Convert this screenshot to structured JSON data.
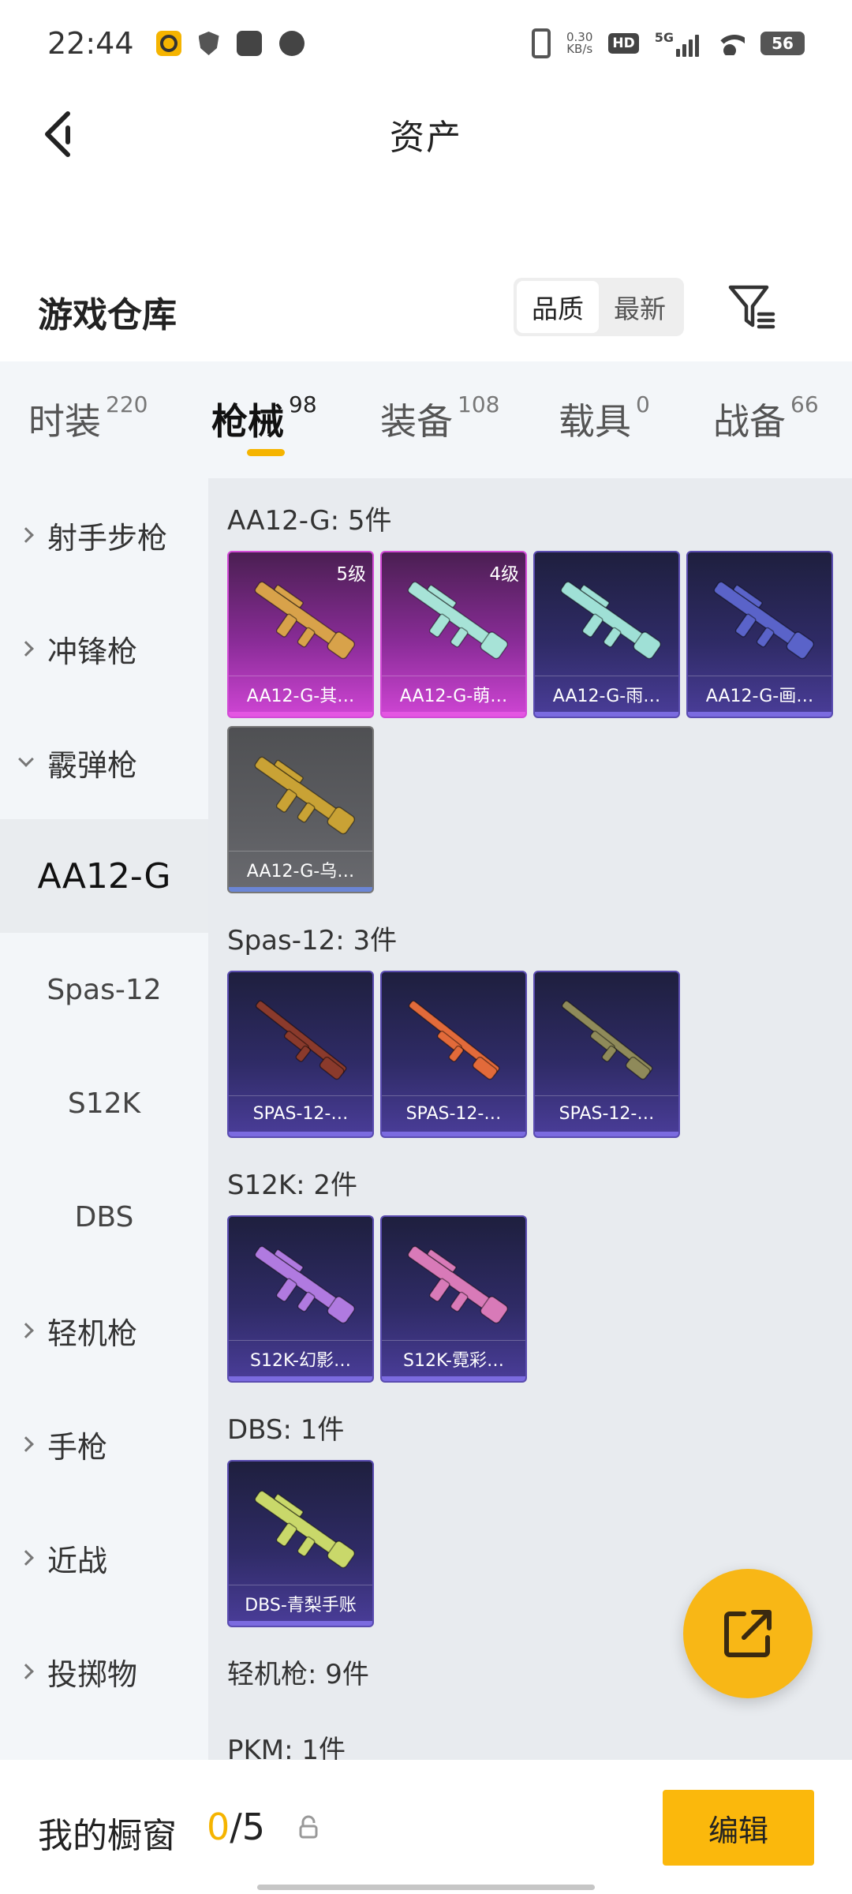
{
  "status_bar": {
    "time": "22:44",
    "net_speed_value": "0.30",
    "net_speed_unit": "KB/s",
    "hd": "HD",
    "network": "5G",
    "battery": "56"
  },
  "header": {
    "title": "资产"
  },
  "warehouse": {
    "title": "游戏仓库",
    "sort_options": [
      "品质",
      "最新"
    ],
    "active_sort": "品质"
  },
  "tabs": [
    {
      "label": "时装",
      "count": "220"
    },
    {
      "label": "枪械",
      "count": "98"
    },
    {
      "label": "装备",
      "count": "108"
    },
    {
      "label": "载具",
      "count": "0"
    },
    {
      "label": "战备",
      "count": "66"
    }
  ],
  "active_tab": "枪械",
  "sidenav": [
    {
      "label": "射手步枪"
    },
    {
      "label": "冲锋枪"
    },
    {
      "label": "霰弹枪"
    },
    {
      "label": "AA12-G"
    },
    {
      "label": "Spas-12"
    },
    {
      "label": "S12K"
    },
    {
      "label": "DBS"
    },
    {
      "label": "轻机枪"
    },
    {
      "label": "手枪"
    },
    {
      "label": "近战"
    },
    {
      "label": "投掷物"
    }
  ],
  "groups": [
    {
      "title": "AA12-G: 5件",
      "items": [
        {
          "name": "AA12-G-其…",
          "level": "5级",
          "rarity": "pink",
          "gun_color": "#d8a24a"
        },
        {
          "name": "AA12-G-萌…",
          "level": "4级",
          "rarity": "pink",
          "gun_color": "#a7e3d7"
        },
        {
          "name": "AA12-G-雨…",
          "level": "",
          "rarity": "purple",
          "gun_color": "#9fe0d6"
        },
        {
          "name": "AA12-G-画…",
          "level": "",
          "rarity": "purple",
          "gun_color": "#5a63c9"
        },
        {
          "name": "AA12-G-乌…",
          "level": "",
          "rarity": "gray",
          "gun_color": "#c9a235"
        }
      ]
    },
    {
      "title": "Spas-12: 3件",
      "items": [
        {
          "name": "SPAS-12-…",
          "level": "",
          "rarity": "purple",
          "gun_color": "#8a3a2c"
        },
        {
          "name": "SPAS-12-…",
          "level": "",
          "rarity": "purple",
          "gun_color": "#e26a3a"
        },
        {
          "name": "SPAS-12-…",
          "level": "",
          "rarity": "purple",
          "gun_color": "#8f8a5a"
        }
      ]
    },
    {
      "title": "S12K: 2件",
      "items": [
        {
          "name": "S12K-幻影…",
          "level": "",
          "rarity": "purple",
          "gun_color": "#b07ae0"
        },
        {
          "name": "S12K-霓彩…",
          "level": "",
          "rarity": "purple",
          "gun_color": "#d87ab8"
        }
      ]
    },
    {
      "title": "DBS: 1件",
      "items": [
        {
          "name": "DBS-青梨手账",
          "level": "",
          "rarity": "purple",
          "gun_color": "#c9d86a"
        }
      ]
    },
    {
      "title": "轻机枪: 9件",
      "items": []
    },
    {
      "title": "PKM: 1件",
      "items": []
    }
  ],
  "showcase": {
    "title": "我的橱窗",
    "current": "0",
    "total": "/5",
    "edit_label": "编辑"
  },
  "colors": {
    "accent": "#f5b400",
    "pink_rarity": "#d24bd6",
    "purple_rarity": "#5a4cb0",
    "gray_rarity": "#777777"
  }
}
